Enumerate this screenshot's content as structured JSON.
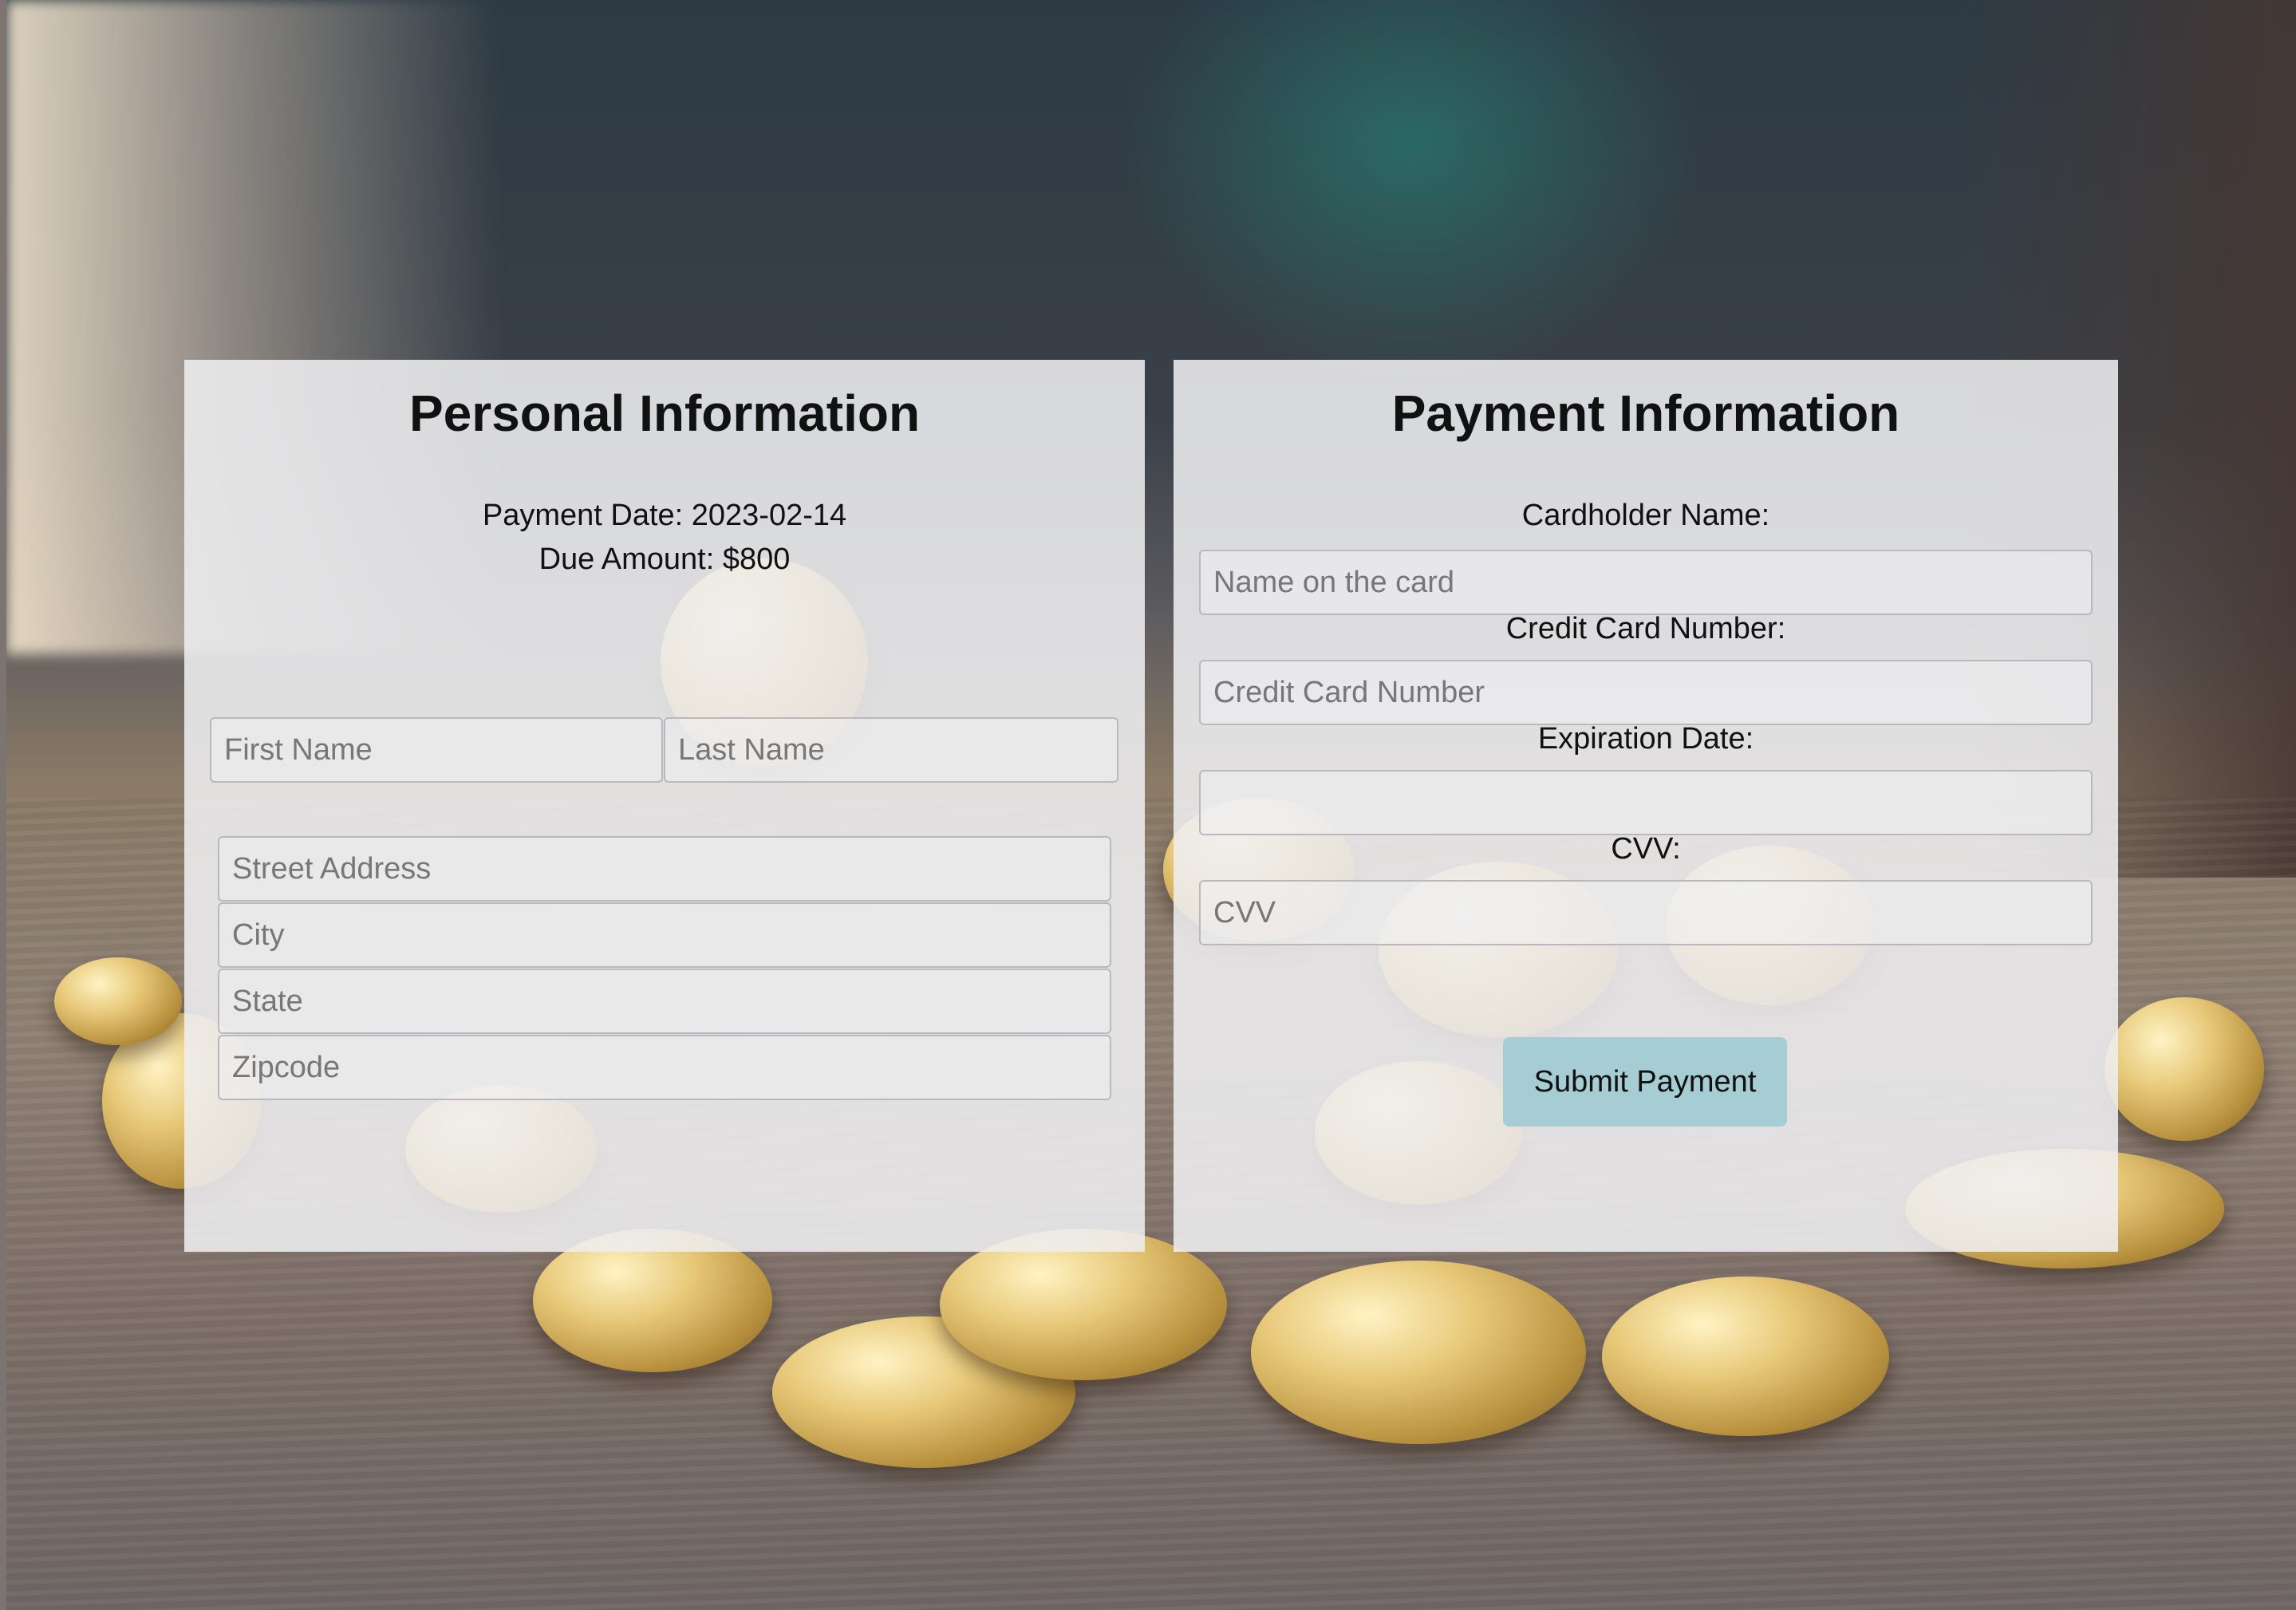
{
  "personal": {
    "title": "Personal Information",
    "payment_date": "Payment Date: 2023-02-14",
    "due_amount": "Due Amount: $800",
    "first_name_placeholder": "First Name",
    "last_name_placeholder": "Last Name",
    "street_placeholder": "Street Address",
    "city_placeholder": "City",
    "state_placeholder": "State",
    "zip_placeholder": "Zipcode"
  },
  "payment": {
    "title": "Payment Information",
    "cardholder_label": "Cardholder Name:",
    "cardholder_placeholder": "Name on the card",
    "card_number_label": "Credit Card Number:",
    "card_number_placeholder": "Credit Card Number",
    "expiration_label": "Expiration Date:",
    "expiration_value": "",
    "cvv_label": "CVV:",
    "cvv_placeholder": "CVV",
    "submit_label": "Submit Payment"
  },
  "colors": {
    "panel_background": "#eeeef0",
    "button_background": "#a6ccd4"
  }
}
